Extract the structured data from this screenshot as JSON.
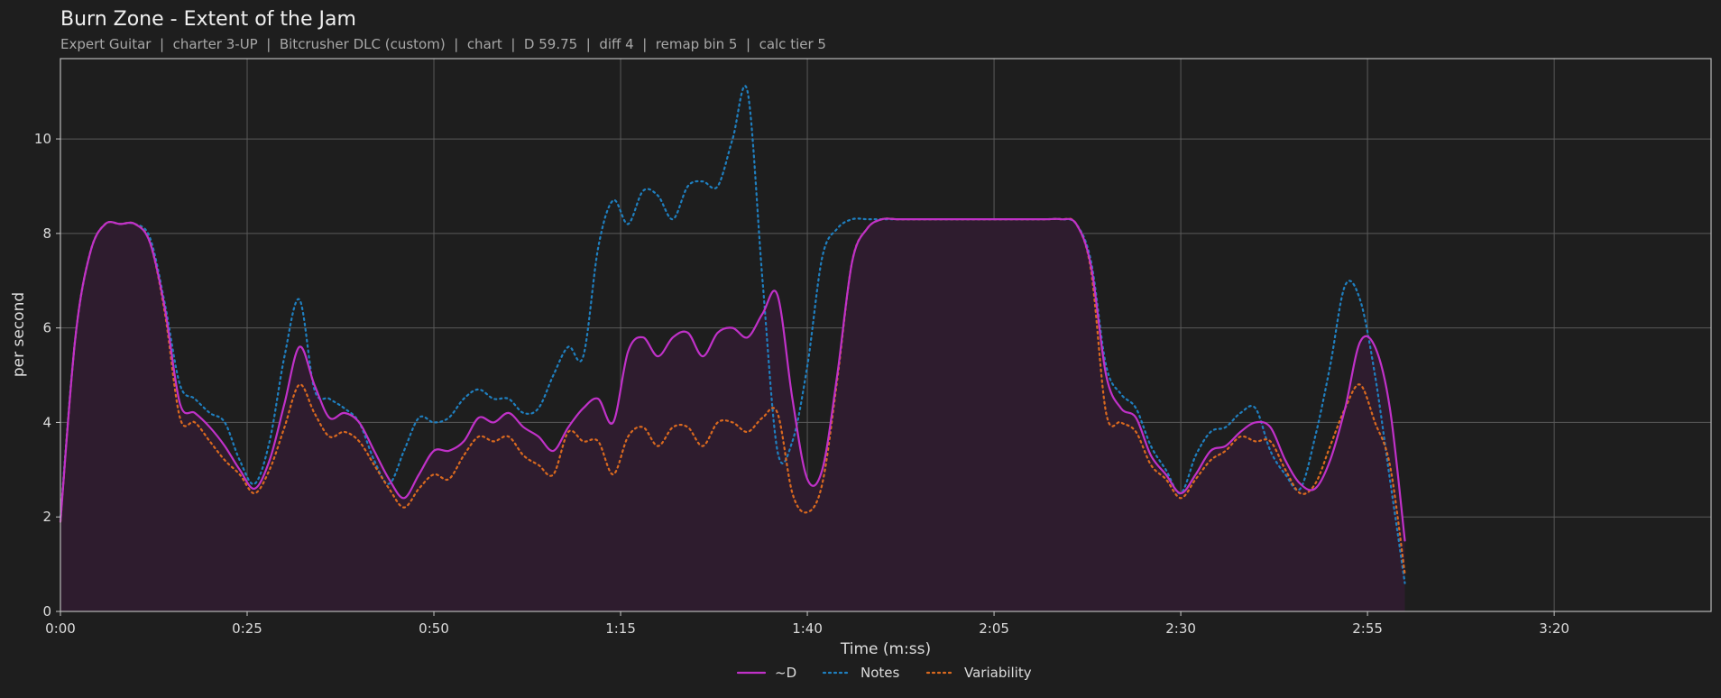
{
  "chart_data": {
    "type": "line",
    "title": "Burn Zone - Extent of the Jam",
    "subtitle": "Expert Guitar  |  charter 3-UP  |  Bitcrusher DLC (custom)  |  chart  |  D 59.75  |  diff 4  |  remap bin 5  |  calc tier 5",
    "xlabel": "Time (m:ss)",
    "ylabel": "per second",
    "xlim": [
      0,
      221
    ],
    "ylim": [
      0,
      11.7
    ],
    "xticks": [
      {
        "value": 0,
        "label": "0:00"
      },
      {
        "value": 25,
        "label": "0:25"
      },
      {
        "value": 50,
        "label": "0:50"
      },
      {
        "value": 75,
        "label": "1:15"
      },
      {
        "value": 100,
        "label": "1:40"
      },
      {
        "value": 125,
        "label": "2:05"
      },
      {
        "value": 150,
        "label": "2:30"
      },
      {
        "value": 175,
        "label": "2:55"
      },
      {
        "value": 200,
        "label": "3:20"
      }
    ],
    "yticks": [
      {
        "value": 0,
        "label": "0"
      },
      {
        "value": 2,
        "label": "2"
      },
      {
        "value": 4,
        "label": "4"
      },
      {
        "value": 6,
        "label": "6"
      },
      {
        "value": 8,
        "label": "8"
      },
      {
        "value": 10,
        "label": "10"
      }
    ],
    "grid": true,
    "legend_position": "bottom-center",
    "x": [
      0,
      2,
      4,
      6,
      8,
      10,
      12,
      14,
      16,
      18,
      20,
      22,
      24,
      26,
      28,
      30,
      32,
      34,
      36,
      38,
      40,
      42,
      44,
      46,
      48,
      50,
      52,
      54,
      56,
      58,
      60,
      62,
      64,
      66,
      68,
      70,
      72,
      74,
      76,
      78,
      80,
      82,
      84,
      86,
      88,
      90,
      92,
      94,
      96,
      98,
      100,
      102,
      104,
      106,
      108,
      110,
      112,
      114,
      116,
      118,
      120,
      122,
      124,
      126,
      128,
      130,
      132,
      134,
      136,
      138,
      140,
      142,
      144,
      146,
      148,
      150,
      152,
      154,
      156,
      158,
      160,
      162,
      164,
      166,
      168,
      170,
      172,
      174,
      176,
      178,
      180,
      182,
      184,
      186,
      188,
      190,
      192,
      194,
      196,
      198,
      200,
      202,
      204,
      206,
      208,
      210,
      212,
      214,
      216,
      218,
      221
    ],
    "series": [
      {
        "name": "~D",
        "color": "#c031c8",
        "style": "solid",
        "fill": "#2e1c2e",
        "values": [
          1.9,
          5.8,
          7.6,
          8.2,
          8.2,
          8.2,
          7.8,
          6.4,
          4.4,
          4.2,
          3.9,
          3.5,
          3.0,
          2.6,
          3.2,
          4.4,
          5.6,
          4.8,
          4.1,
          4.2,
          4.0,
          3.4,
          2.8,
          2.4,
          2.9,
          3.4,
          3.4,
          3.6,
          4.1,
          4.0,
          4.2,
          3.9,
          3.7,
          3.4,
          3.9,
          4.3,
          4.5,
          4.0,
          5.5,
          5.8,
          5.4,
          5.8,
          5.9,
          5.4,
          5.9,
          6.0,
          5.8,
          6.3,
          6.7,
          4.5,
          2.8,
          3.0,
          5.0,
          7.4,
          8.1,
          8.3,
          8.3,
          8.3,
          8.3,
          8.3,
          8.3,
          8.3,
          8.3,
          8.3,
          8.3,
          8.3,
          8.3,
          8.3,
          8.2,
          7.3,
          5.0,
          4.3,
          4.1,
          3.3,
          2.9,
          2.5,
          2.9,
          3.4,
          3.5,
          3.8,
          4.0,
          3.9,
          3.2,
          2.7,
          2.6,
          3.2,
          4.3,
          5.7,
          5.6,
          4.3,
          1.5
        ],
        "marker_x": []
      },
      {
        "name": "Notes",
        "color": "#1f7fbf",
        "style": "dotted",
        "values": [
          2.0,
          5.8,
          7.6,
          8.2,
          8.2,
          8.2,
          7.9,
          6.5,
          4.8,
          4.5,
          4.2,
          4.0,
          3.2,
          2.7,
          3.6,
          5.4,
          6.6,
          4.7,
          4.5,
          4.3,
          4.0,
          3.2,
          2.7,
          3.4,
          4.1,
          4.0,
          4.1,
          4.5,
          4.7,
          4.5,
          4.5,
          4.2,
          4.3,
          5.0,
          5.6,
          5.4,
          7.7,
          8.7,
          8.2,
          8.9,
          8.8,
          8.3,
          9.0,
          9.1,
          9.0,
          10.0,
          11.0,
          7.0,
          3.4,
          3.6,
          5.2,
          7.5,
          8.1,
          8.3,
          8.3,
          8.3,
          8.3,
          8.3,
          8.3,
          8.3,
          8.3,
          8.3,
          8.3,
          8.3,
          8.3,
          8.3,
          8.3,
          8.3,
          8.2,
          7.4,
          5.2,
          4.6,
          4.3,
          3.5,
          3.0,
          2.5,
          3.3,
          3.8,
          3.9,
          4.2,
          4.3,
          3.4,
          2.9,
          2.6,
          3.7,
          5.2,
          6.9,
          6.6,
          5.0,
          2.8,
          0.6
        ],
        "marker_x": []
      },
      {
        "name": "Variability",
        "color": "#d9691f",
        "style": "dotted",
        "values": [
          1.9,
          5.8,
          7.6,
          8.2,
          8.2,
          8.2,
          7.8,
          6.3,
          4.1,
          4.0,
          3.6,
          3.2,
          2.9,
          2.5,
          3.0,
          3.9,
          4.8,
          4.2,
          3.7,
          3.8,
          3.6,
          3.1,
          2.6,
          2.2,
          2.6,
          2.9,
          2.8,
          3.3,
          3.7,
          3.6,
          3.7,
          3.3,
          3.1,
          2.9,
          3.8,
          3.6,
          3.6,
          2.9,
          3.7,
          3.9,
          3.5,
          3.9,
          3.9,
          3.5,
          4.0,
          4.0,
          3.8,
          4.1,
          4.2,
          2.5,
          2.1,
          2.7,
          4.9,
          7.4,
          8.1,
          8.3,
          8.3,
          8.3,
          8.3,
          8.3,
          8.3,
          8.3,
          8.3,
          8.3,
          8.3,
          8.3,
          8.3,
          8.3,
          8.2,
          7.2,
          4.2,
          4.0,
          3.8,
          3.1,
          2.8,
          2.4,
          2.8,
          3.2,
          3.4,
          3.7,
          3.6,
          3.6,
          3.0,
          2.5,
          2.7,
          3.5,
          4.3,
          4.8,
          4.0,
          3.1,
          0.8
        ],
        "marker_x": []
      }
    ]
  }
}
